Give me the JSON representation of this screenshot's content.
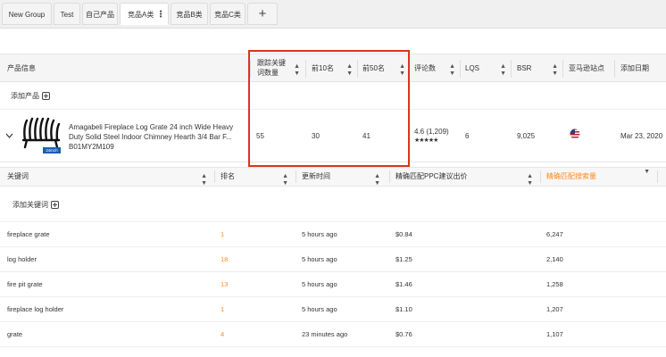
{
  "tabs": [
    {
      "label": "New Group",
      "active": false
    },
    {
      "label": "Test",
      "active": false
    },
    {
      "label": "自己产品",
      "active": false
    },
    {
      "label": "竞品A类",
      "active": true
    },
    {
      "label": "竞品B类",
      "active": false
    },
    {
      "label": "竞品C类",
      "active": false
    }
  ],
  "tab_add_label": "+",
  "tab_menu_glyph": "⋮",
  "product_table": {
    "headers": {
      "product_info": "产品信息",
      "tracked_keywords_line1": "跟踪关键",
      "tracked_keywords_line2": "词数量",
      "top10": "前10名",
      "top50": "前50名",
      "reviews": "评论数",
      "lqs": "LQS",
      "bsr": "BSR",
      "site": "亚马逊站点",
      "date_added": "添加日期"
    },
    "add_product_label": "添加产品",
    "product": {
      "thumb_badge": "24inch",
      "title_line1": "Amagabeli Fireplace Log Grate 24 inch Wide Heavy",
      "title_line2": "Duty Solid Steel Indoor Chimney Hearth 3/4 Bar F...",
      "asin": "B01MY2M109",
      "tracked_keywords": "55",
      "top10": "30",
      "top50": "41",
      "rating": "4.6 (1,209)",
      "stars": "★★★★★",
      "lqs": "6",
      "bsr": "9,025",
      "date_added": "Mar 23, 2020"
    }
  },
  "keyword_table": {
    "headers": {
      "keyword": "关键词",
      "rank": "排名",
      "updated": "更新时间",
      "ppc": "精确匹配PPC建议出价",
      "volume": "精确匹配搜索量"
    },
    "add_keyword_label": "添加关键词",
    "rows": [
      {
        "keyword": "fireplace grate",
        "rank": "1",
        "updated": "5 hours ago",
        "ppc": "$0.84",
        "volume": "6,247"
      },
      {
        "keyword": "log holder",
        "rank": "18",
        "updated": "5 hours ago",
        "ppc": "$1.25",
        "volume": "2,140"
      },
      {
        "keyword": "fire pit grate",
        "rank": "13",
        "updated": "5 hours ago",
        "ppc": "$1.46",
        "volume": "1,258"
      },
      {
        "keyword": "fireplace log holder",
        "rank": "1",
        "updated": "5 hours ago",
        "ppc": "$1.10",
        "volume": "1,207"
      },
      {
        "keyword": "grate",
        "rank": "4",
        "updated": "23 minutes ago",
        "ppc": "$0.76",
        "volume": "1,107"
      }
    ]
  },
  "colors": {
    "accent_orange": "#ff8a1f",
    "highlight_red": "#e0311f",
    "flag_blue": "#3c3b6e",
    "flag_red": "#b22234"
  }
}
